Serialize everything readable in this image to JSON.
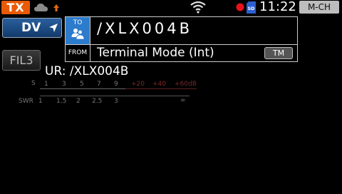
{
  "status_bar": {
    "tx_label": "TX",
    "time": "11:22",
    "mode": "M-CH",
    "icons": [
      "cloud-icon",
      "upload-arrow-icon",
      "wifi-icon",
      "record-icon",
      "sd-card-icon"
    ]
  },
  "left_buttons": {
    "dv_label": "DV",
    "filter_label": "FIL3"
  },
  "call_panel": {
    "to_label": "TO",
    "to_value": "/XLX004B",
    "from_label": "FROM",
    "from_value": "Terminal Mode (Int)",
    "tm_label": "TM"
  },
  "ur_line": "UR: /XLX004B",
  "s_meter": {
    "label": "S",
    "ticks": [
      "1",
      "3",
      "5",
      "7",
      "9"
    ],
    "ticks_over": [
      "+20",
      "+40",
      "+60dB"
    ]
  },
  "swr_meter": {
    "label": "SWR",
    "ticks": [
      "1",
      "1.5",
      "2",
      "2.5",
      "3",
      "∞"
    ]
  },
  "colors": {
    "tx_badge": "#e85a08",
    "dv_button": "#1f4f8a",
    "to_box": "#2c7bcc",
    "record_dot": "#e8121a"
  }
}
